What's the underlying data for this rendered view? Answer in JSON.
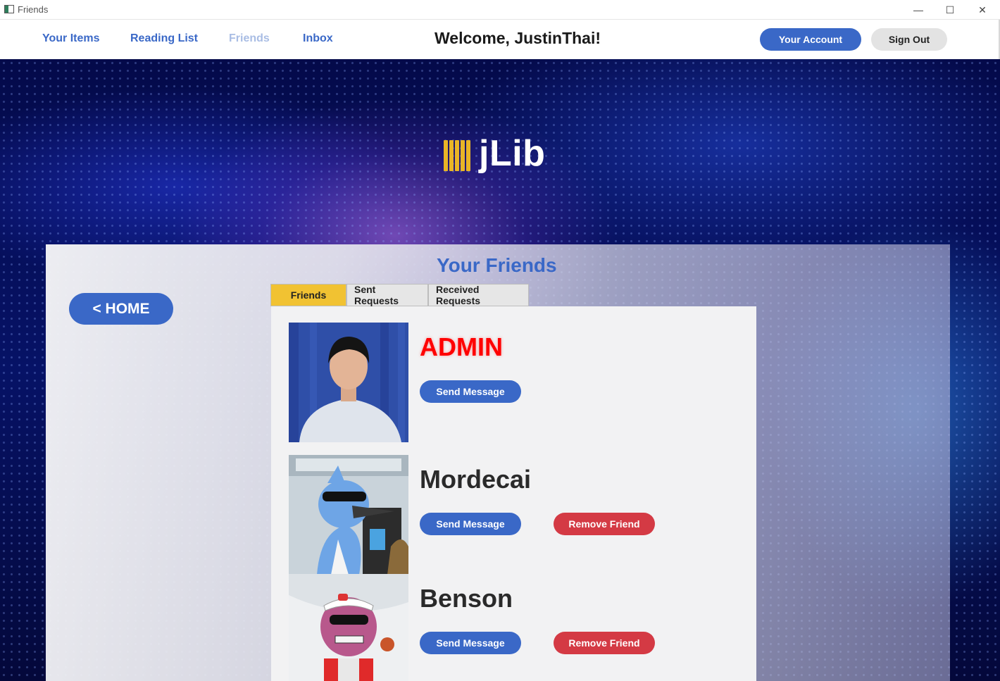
{
  "window": {
    "title": "Friends",
    "minimize_glyph": "—",
    "maximize_glyph": "☐",
    "close_glyph": "✕"
  },
  "nav": {
    "items": [
      {
        "label": "Your Items"
      },
      {
        "label": "Reading List"
      },
      {
        "label": "Friends",
        "active": true
      },
      {
        "label": "Inbox"
      }
    ],
    "welcome": "Welcome, JustinThai!",
    "account_label": "Your Account",
    "signout_label": "Sign Out"
  },
  "brand": {
    "name": "jLib",
    "icon": "books-icon"
  },
  "panel": {
    "title": "Your Friends",
    "home_label": "< HOME",
    "tabs": [
      {
        "label": "Friends",
        "active": true
      },
      {
        "label": "Sent Requests"
      },
      {
        "label": "Received Requests"
      }
    ]
  },
  "friends": [
    {
      "name": "ADMIN",
      "send_label": "Send Message"
    },
    {
      "name": "Mordecai",
      "send_label": "Send Message",
      "remove_label": "Remove Friend"
    },
    {
      "name": "Benson",
      "send_label": "Send Message",
      "remove_label": "Remove Friend"
    }
  ],
  "colors": {
    "accent_blue": "#3a68c7",
    "admin_red": "#ff0000",
    "remove_red": "#d43a44",
    "active_tab_yellow": "#f1c232",
    "logo_gold": "#e9b526"
  }
}
